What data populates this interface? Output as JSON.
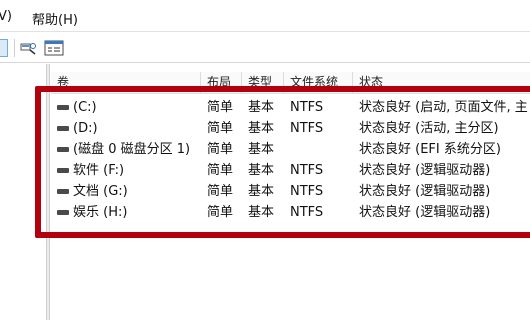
{
  "menubar": {
    "view_partial": "V)",
    "help": "帮助(H)"
  },
  "toolbar": {
    "icons": [
      "view-button-icon",
      "search-icon",
      "properties-icon"
    ]
  },
  "table": {
    "headers": {
      "volume": "卷",
      "layout": "布局",
      "type": "类型",
      "filesystem": "文件系统",
      "status": "状态"
    },
    "rows": [
      {
        "volume": "(C:)",
        "layout": "简单",
        "type": "基本",
        "filesystem": "NTFS",
        "status": "状态良好 (启动, 页面文件, 主"
      },
      {
        "volume": "(D:)",
        "layout": "简单",
        "type": "基本",
        "filesystem": "NTFS",
        "status": "状态良好 (活动, 主分区)"
      },
      {
        "volume": "(磁盘 0 磁盘分区 1)",
        "layout": "简单",
        "type": "基本",
        "filesystem": "",
        "status": "状态良好 (EFI 系统分区)"
      },
      {
        "volume": "软件 (F:)",
        "layout": "简单",
        "type": "基本",
        "filesystem": "NTFS",
        "status": "状态良好 (逻辑驱动器)"
      },
      {
        "volume": "文档 (G:)",
        "layout": "简单",
        "type": "基本",
        "filesystem": "NTFS",
        "status": "状态良好 (逻辑驱动器)"
      },
      {
        "volume": "娱乐 (H:)",
        "layout": "简单",
        "type": "基本",
        "filesystem": "NTFS",
        "status": "状态良好 (逻辑驱动器)"
      }
    ]
  },
  "highlight": {
    "color": "#b3000f"
  }
}
